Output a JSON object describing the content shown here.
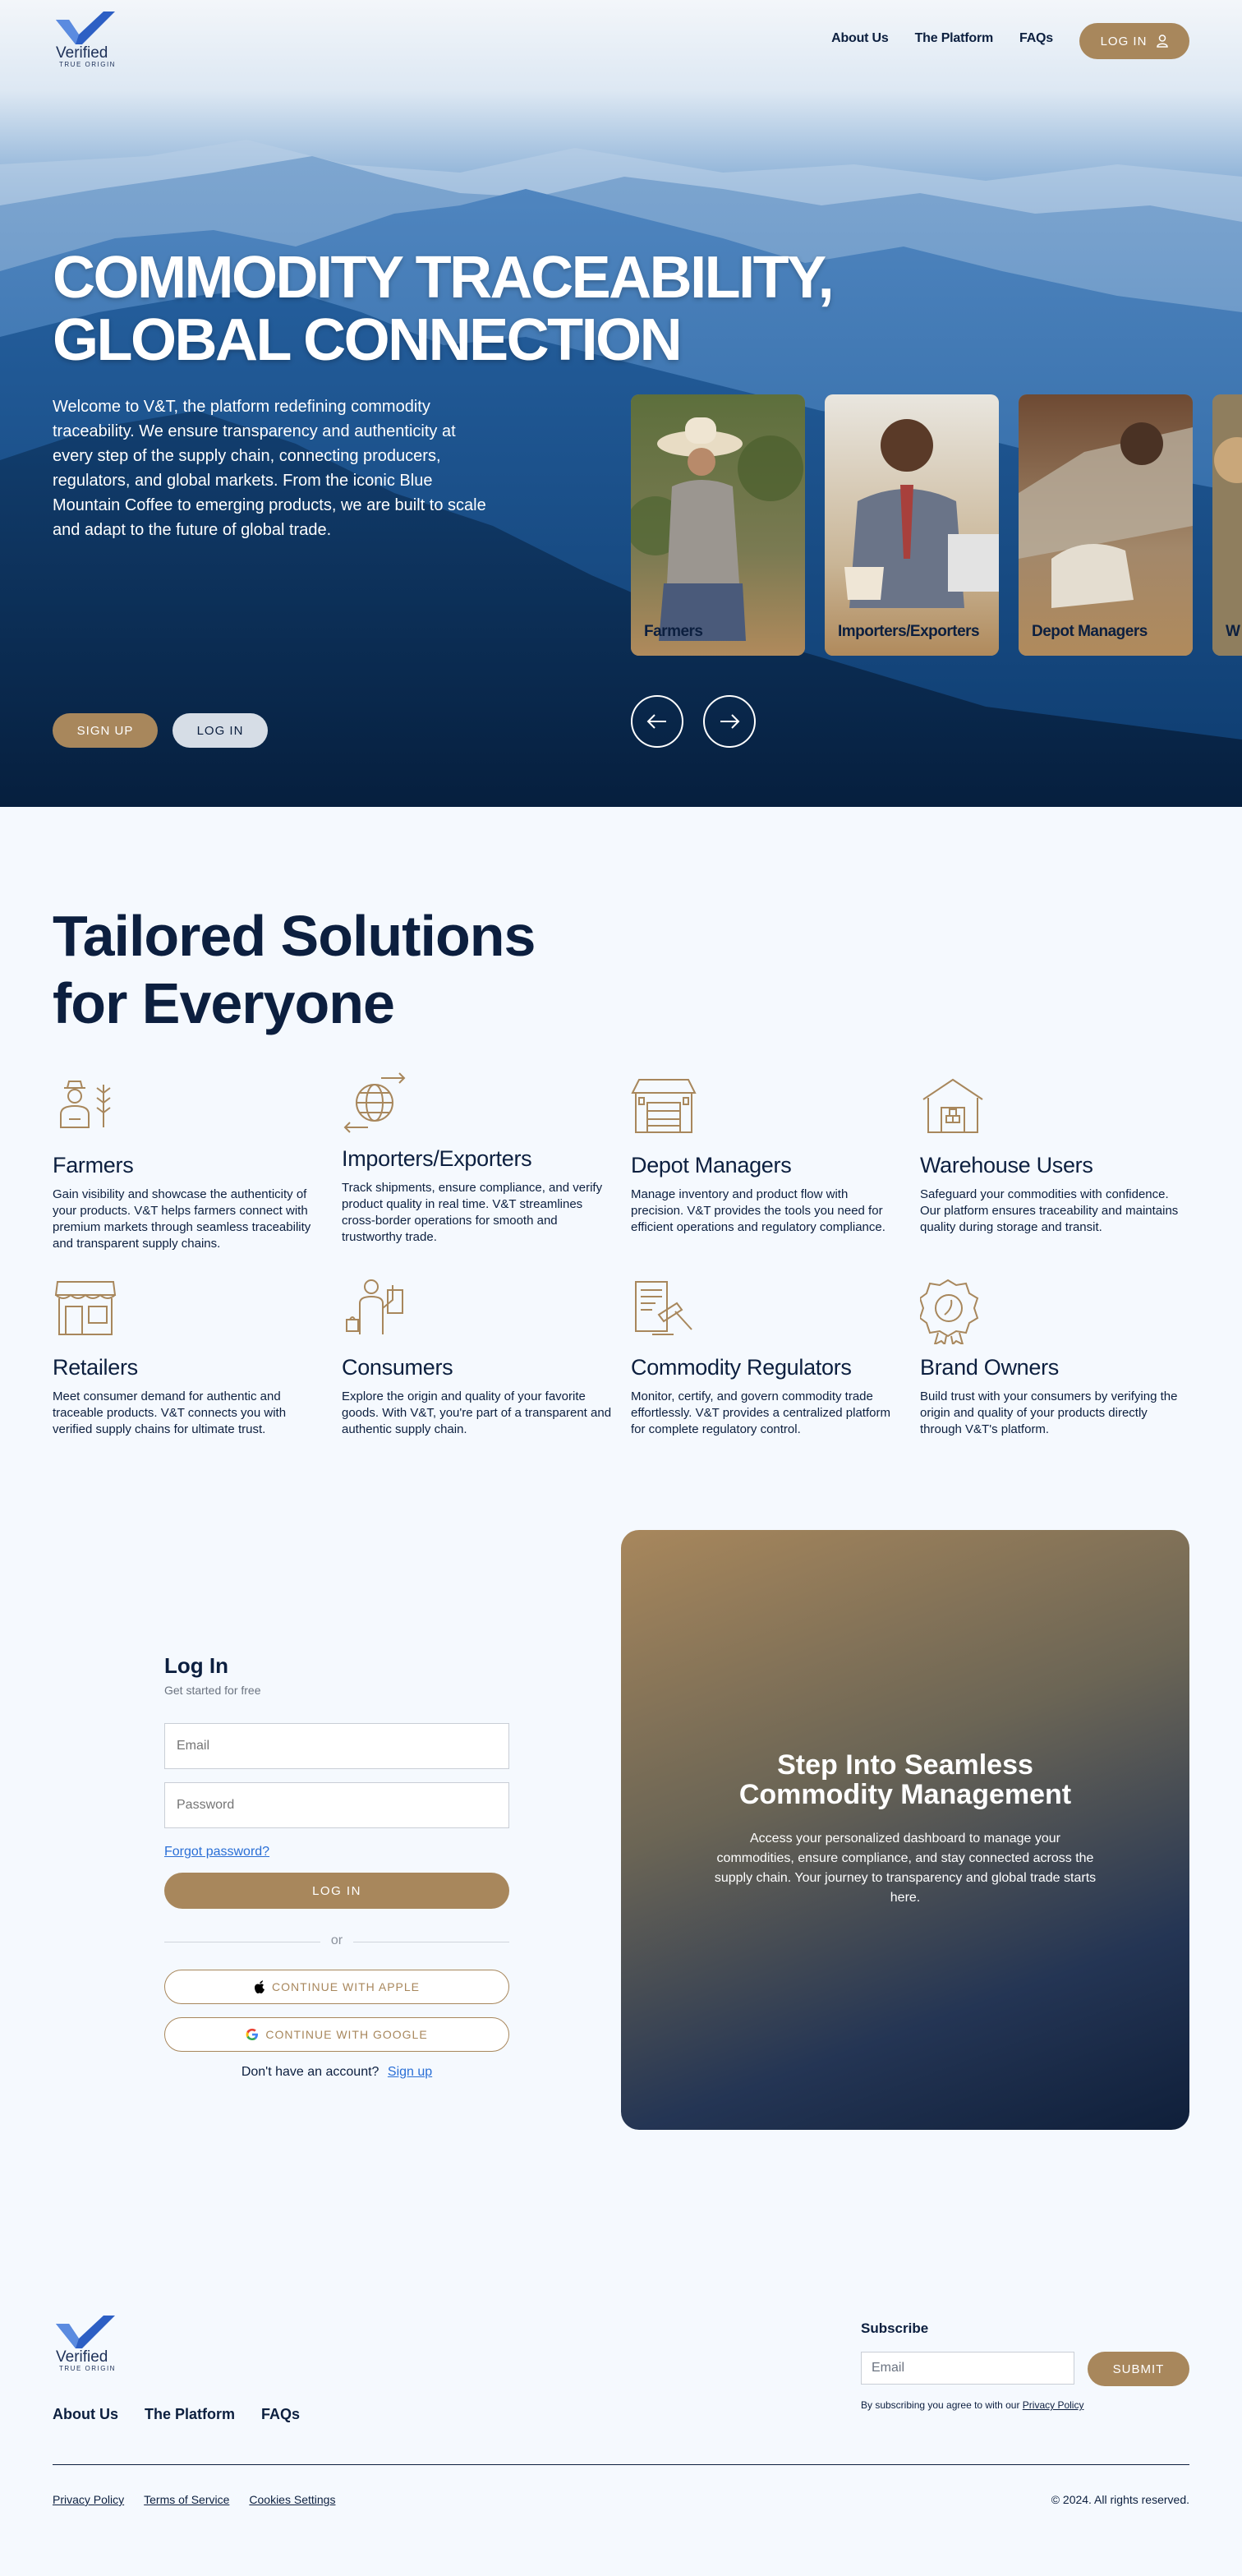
{
  "nav": {
    "logo_word": "Verified",
    "logo_sub": "TRUE ORIGIN",
    "links": [
      "About Us",
      "The Platform",
      "FAQs"
    ],
    "login": "LOG IN"
  },
  "hero": {
    "title_line1": "COMMODITY TRACEABILITY,",
    "title_line2": "GLOBAL CONNECTION",
    "description": "Welcome to V&T, the platform redefining commodity traceability. We ensure transparency and authenticity at every step of the supply chain, connecting producers, regulators, and global markets. From the iconic Blue Mountain Coffee to emerging products, we are built to scale and adapt to the future of global trade.",
    "signup": "SIGN UP",
    "login": "LOG IN",
    "cards": [
      "Farmers",
      "Importers/Exporters",
      "Depot Managers",
      "W"
    ]
  },
  "solutions": {
    "title_line1": "Tailored Solutions",
    "title_line2": "for Everyone",
    "items": [
      {
        "title": "Farmers",
        "icon": "farmer-icon",
        "text": "Gain visibility and showcase the authenticity of your products. V&T helps farmers connect with premium markets through seamless traceability and transparent supply chains."
      },
      {
        "title": "Importers/Exporters",
        "icon": "globe-exchange-icon",
        "text": "Track shipments, ensure compliance, and verify product quality in real time. V&T streamlines cross-border operations for smooth and trustworthy trade."
      },
      {
        "title": "Depot Managers",
        "icon": "depot-icon",
        "text": "Manage inventory and product flow with precision. V&T provides the tools you need for efficient operations and regulatory compliance."
      },
      {
        "title": "Warehouse Users",
        "icon": "warehouse-icon",
        "text": "Safeguard your commodities with confidence. Our platform ensures traceability and maintains quality during storage and transit."
      },
      {
        "title": "Retailers",
        "icon": "storefront-icon",
        "text": "Meet consumer demand for authentic and traceable products. V&T connects you with verified supply chains for ultimate trust."
      },
      {
        "title": "Consumers",
        "icon": "consumer-icon",
        "text": "Explore the origin and quality of your favorite goods. With V&T, you're part of a transparent and authentic supply chain."
      },
      {
        "title": "Commodity Regulators",
        "icon": "regulator-icon",
        "text": "Monitor, certify, and govern commodity trade effortlessly. V&T provides a centralized platform for complete regulatory control."
      },
      {
        "title": "Brand Owners",
        "icon": "badge-icon",
        "text": "Build trust with your consumers by verifying the origin and quality of your products directly through V&T's platform."
      }
    ]
  },
  "login_form": {
    "title": "Log In",
    "subtitle": "Get started for free",
    "email_placeholder": "Email",
    "password_placeholder": "Password",
    "forgot": "Forgot password?",
    "submit": "LOG IN",
    "or": "or",
    "apple": "CONTINUE WITH APPLE",
    "google": "CONTINUE WITH GOOGLE",
    "no_account": "Don't have an account?",
    "signup": "Sign up"
  },
  "promo": {
    "title_line1": "Step Into Seamless",
    "title_line2": "Commodity Management",
    "text": "Access your personalized dashboard to manage your commodities, ensure compliance, and stay connected across the supply chain. Your journey to transparency and global trade starts here."
  },
  "footer": {
    "links": [
      "About Us",
      "The Platform",
      "FAQs"
    ],
    "subscribe_title": "Subscribe",
    "email_placeholder": "Email",
    "submit": "SUBMIT",
    "note": "By subscribing you agree to with our",
    "note_link": "Privacy Policy",
    "legal": [
      "Privacy Policy",
      "Terms of Service",
      "Cookies Settings"
    ],
    "copyright": "© 2024. All rights reserved."
  },
  "colors": {
    "accent": "#a8875c",
    "navy": "#0c1f3f",
    "link": "#2a6fd6",
    "background": "#f5f9fe"
  }
}
